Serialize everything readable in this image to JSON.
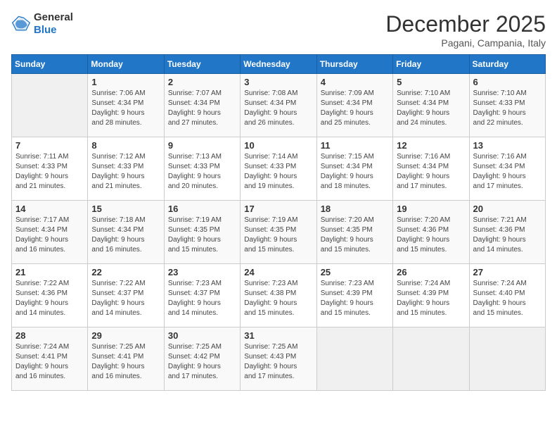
{
  "header": {
    "logo_general": "General",
    "logo_blue": "Blue",
    "month_title": "December 2025",
    "subtitle": "Pagani, Campania, Italy"
  },
  "columns": [
    "Sunday",
    "Monday",
    "Tuesday",
    "Wednesday",
    "Thursday",
    "Friday",
    "Saturday"
  ],
  "weeks": [
    [
      {
        "day": "",
        "info": ""
      },
      {
        "day": "1",
        "info": "Sunrise: 7:06 AM\nSunset: 4:34 PM\nDaylight: 9 hours\nand 28 minutes."
      },
      {
        "day": "2",
        "info": "Sunrise: 7:07 AM\nSunset: 4:34 PM\nDaylight: 9 hours\nand 27 minutes."
      },
      {
        "day": "3",
        "info": "Sunrise: 7:08 AM\nSunset: 4:34 PM\nDaylight: 9 hours\nand 26 minutes."
      },
      {
        "day": "4",
        "info": "Sunrise: 7:09 AM\nSunset: 4:34 PM\nDaylight: 9 hours\nand 25 minutes."
      },
      {
        "day": "5",
        "info": "Sunrise: 7:10 AM\nSunset: 4:34 PM\nDaylight: 9 hours\nand 24 minutes."
      },
      {
        "day": "6",
        "info": "Sunrise: 7:10 AM\nSunset: 4:33 PM\nDaylight: 9 hours\nand 22 minutes."
      }
    ],
    [
      {
        "day": "7",
        "info": "Sunrise: 7:11 AM\nSunset: 4:33 PM\nDaylight: 9 hours\nand 21 minutes."
      },
      {
        "day": "8",
        "info": "Sunrise: 7:12 AM\nSunset: 4:33 PM\nDaylight: 9 hours\nand 21 minutes."
      },
      {
        "day": "9",
        "info": "Sunrise: 7:13 AM\nSunset: 4:33 PM\nDaylight: 9 hours\nand 20 minutes."
      },
      {
        "day": "10",
        "info": "Sunrise: 7:14 AM\nSunset: 4:33 PM\nDaylight: 9 hours\nand 19 minutes."
      },
      {
        "day": "11",
        "info": "Sunrise: 7:15 AM\nSunset: 4:34 PM\nDaylight: 9 hours\nand 18 minutes."
      },
      {
        "day": "12",
        "info": "Sunrise: 7:16 AM\nSunset: 4:34 PM\nDaylight: 9 hours\nand 17 minutes."
      },
      {
        "day": "13",
        "info": "Sunrise: 7:16 AM\nSunset: 4:34 PM\nDaylight: 9 hours\nand 17 minutes."
      }
    ],
    [
      {
        "day": "14",
        "info": "Sunrise: 7:17 AM\nSunset: 4:34 PM\nDaylight: 9 hours\nand 16 minutes."
      },
      {
        "day": "15",
        "info": "Sunrise: 7:18 AM\nSunset: 4:34 PM\nDaylight: 9 hours\nand 16 minutes."
      },
      {
        "day": "16",
        "info": "Sunrise: 7:19 AM\nSunset: 4:35 PM\nDaylight: 9 hours\nand 15 minutes."
      },
      {
        "day": "17",
        "info": "Sunrise: 7:19 AM\nSunset: 4:35 PM\nDaylight: 9 hours\nand 15 minutes."
      },
      {
        "day": "18",
        "info": "Sunrise: 7:20 AM\nSunset: 4:35 PM\nDaylight: 9 hours\nand 15 minutes."
      },
      {
        "day": "19",
        "info": "Sunrise: 7:20 AM\nSunset: 4:36 PM\nDaylight: 9 hours\nand 15 minutes."
      },
      {
        "day": "20",
        "info": "Sunrise: 7:21 AM\nSunset: 4:36 PM\nDaylight: 9 hours\nand 14 minutes."
      }
    ],
    [
      {
        "day": "21",
        "info": "Sunrise: 7:22 AM\nSunset: 4:36 PM\nDaylight: 9 hours\nand 14 minutes."
      },
      {
        "day": "22",
        "info": "Sunrise: 7:22 AM\nSunset: 4:37 PM\nDaylight: 9 hours\nand 14 minutes."
      },
      {
        "day": "23",
        "info": "Sunrise: 7:23 AM\nSunset: 4:37 PM\nDaylight: 9 hours\nand 14 minutes."
      },
      {
        "day": "24",
        "info": "Sunrise: 7:23 AM\nSunset: 4:38 PM\nDaylight: 9 hours\nand 15 minutes."
      },
      {
        "day": "25",
        "info": "Sunrise: 7:23 AM\nSunset: 4:39 PM\nDaylight: 9 hours\nand 15 minutes."
      },
      {
        "day": "26",
        "info": "Sunrise: 7:24 AM\nSunset: 4:39 PM\nDaylight: 9 hours\nand 15 minutes."
      },
      {
        "day": "27",
        "info": "Sunrise: 7:24 AM\nSunset: 4:40 PM\nDaylight: 9 hours\nand 15 minutes."
      }
    ],
    [
      {
        "day": "28",
        "info": "Sunrise: 7:24 AM\nSunset: 4:41 PM\nDaylight: 9 hours\nand 16 minutes."
      },
      {
        "day": "29",
        "info": "Sunrise: 7:25 AM\nSunset: 4:41 PM\nDaylight: 9 hours\nand 16 minutes."
      },
      {
        "day": "30",
        "info": "Sunrise: 7:25 AM\nSunset: 4:42 PM\nDaylight: 9 hours\nand 17 minutes."
      },
      {
        "day": "31",
        "info": "Sunrise: 7:25 AM\nSunset: 4:43 PM\nDaylight: 9 hours\nand 17 minutes."
      },
      {
        "day": "",
        "info": ""
      },
      {
        "day": "",
        "info": ""
      },
      {
        "day": "",
        "info": ""
      }
    ]
  ]
}
